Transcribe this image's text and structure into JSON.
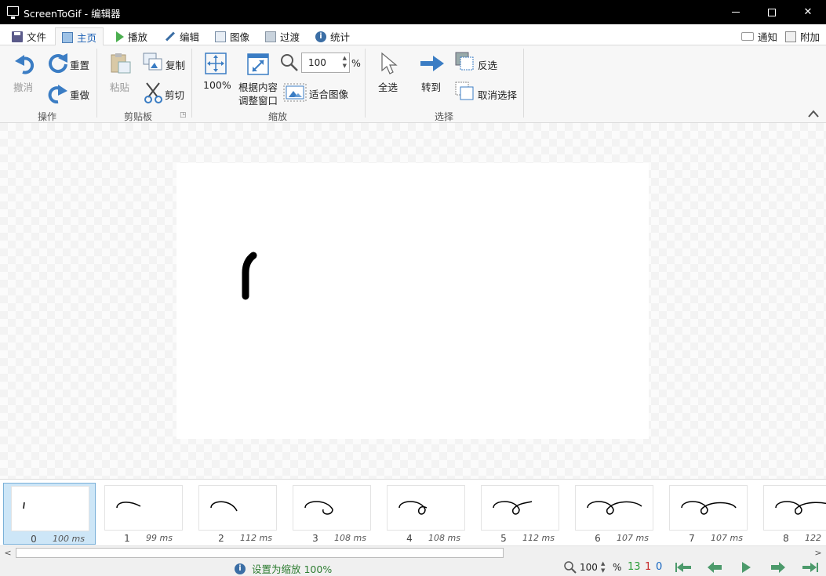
{
  "window": {
    "title": "ScreenToGif - 编辑器",
    "minimize": "",
    "maximize": "",
    "close": "✕"
  },
  "tabs": [
    {
      "label": "文件",
      "icon": "save-icon"
    },
    {
      "label": "主页",
      "icon": "home-icon",
      "active": true
    },
    {
      "label": "播放",
      "icon": "play-icon"
    },
    {
      "label": "编辑",
      "icon": "pen-icon"
    },
    {
      "label": "图像",
      "icon": "image-icon"
    },
    {
      "label": "过渡",
      "icon": "transition-icon"
    },
    {
      "label": "统计",
      "icon": "info-icon"
    }
  ],
  "right_tabs": {
    "notify": "通知",
    "extras": "附加"
  },
  "ribbon": {
    "actions": {
      "group": "操作",
      "undo": "撤消",
      "reset": "重置",
      "redo": "重做"
    },
    "clipboard": {
      "group": "剪贴板",
      "paste": "粘贴",
      "copy": "复制",
      "cut": "剪切"
    },
    "zoom": {
      "group": "缩放",
      "fit100": "100%",
      "fit_window_1": "根据内容",
      "fit_window_2": "调整窗口",
      "fit_image": "适合图像",
      "value": "100",
      "unit": "%"
    },
    "select": {
      "group": "选择",
      "select_all": "全选",
      "goto": "转到",
      "invert": "反选",
      "deselect": "取消选择"
    }
  },
  "frames": [
    {
      "num": "0",
      "dur": "100 ms"
    },
    {
      "num": "1",
      "dur": "99 ms"
    },
    {
      "num": "2",
      "dur": "112 ms"
    },
    {
      "num": "3",
      "dur": "108 ms"
    },
    {
      "num": "4",
      "dur": "108 ms"
    },
    {
      "num": "5",
      "dur": "112 ms"
    },
    {
      "num": "6",
      "dur": "107 ms"
    },
    {
      "num": "7",
      "dur": "107 ms"
    },
    {
      "num": "8",
      "dur": "122"
    }
  ],
  "status": {
    "message": "设置为缩放 100%",
    "zoom": "100",
    "zoom_unit": "%",
    "count_total": "13",
    "count_selected": "1",
    "count_other": "0"
  },
  "colors": {
    "accent": "#3b7dc4",
    "status_green": "#2e7d32",
    "nav_green": "#4c9a6b"
  }
}
